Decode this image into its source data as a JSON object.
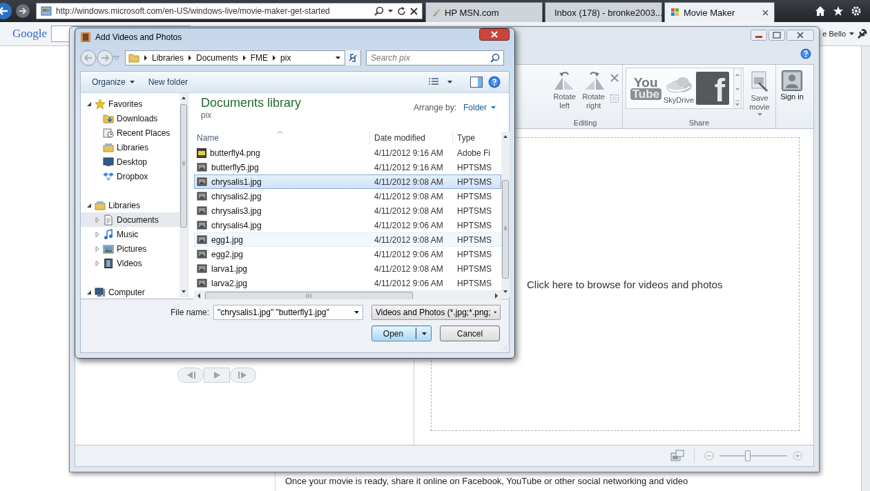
{
  "browser": {
    "address": "http://windows.microsoft.com/en-US/windows-live/movie-maker-get-started",
    "tabs": [
      {
        "label": "HP MSN.com",
        "selected": false
      },
      {
        "label": "Inbox (178) - bronke2003...",
        "selected": false
      },
      {
        "label": "Movie Maker",
        "selected": true
      }
    ],
    "search_logo": "Google",
    "account": "e Bello"
  },
  "page": {
    "paragraph": "Once your movie is ready, share it online on Facebook, YouTube or other social networking and video"
  },
  "movie_maker": {
    "ribbon_groups": [
      {
        "label": "Editing",
        "items": [
          {
            "kind": "rotate_left",
            "label": "Rotate left"
          },
          {
            "kind": "rotate_right",
            "label": "Rotate right"
          },
          {
            "kind": "remove_select"
          }
        ]
      },
      {
        "label": "Share",
        "items": [
          {
            "kind": "youtube",
            "logo": [
              "You",
              "Tube"
            ]
          },
          {
            "kind": "skydrive",
            "label": "SkyDrive"
          },
          {
            "kind": "facebook",
            "logo": [
              "f"
            ]
          },
          {
            "kind": "gallery_scroll"
          },
          {
            "kind": "save_movie",
            "label": "Save movie"
          }
        ]
      },
      {
        "items": [
          {
            "kind": "sign_in",
            "label": "Sign in"
          }
        ]
      }
    ],
    "storyboard_prompt": "Click here to browse for videos and photos",
    "zoom": {
      "level": 0.42
    }
  },
  "dialog": {
    "title": "Add Videos and Photos",
    "breadcrumb": [
      "Libraries",
      "Documents",
      "FME",
      "pix"
    ],
    "search": {
      "placeholder": "Search pix"
    },
    "toolbar": [
      {
        "label": "Organize",
        "menu": true
      },
      {
        "label": "New folder",
        "menu": false
      }
    ],
    "nav_tree": [
      {
        "label": "Favorites",
        "kind": "star",
        "expanded": true,
        "selected": false,
        "children": [
          {
            "label": "Downloads",
            "kind": "downloads",
            "selected": false
          },
          {
            "label": "Recent Places",
            "kind": "recent",
            "selected": false
          },
          {
            "label": "Libraries",
            "kind": "libraries",
            "selected": false
          },
          {
            "label": "Desktop",
            "kind": "desktop",
            "selected": false
          },
          {
            "label": "Dropbox",
            "kind": "dropbox",
            "selected": false
          }
        ]
      },
      {
        "label": "Libraries",
        "kind": "libraries",
        "expanded": true,
        "selected": false,
        "children": [
          {
            "label": "Documents",
            "kind": "document",
            "expanded": false,
            "selected": true
          },
          {
            "label": "Music",
            "kind": "music",
            "expanded": false,
            "selected": false
          },
          {
            "label": "Pictures",
            "kind": "pictures",
            "expanded": false,
            "selected": false
          },
          {
            "label": "Videos",
            "kind": "videos",
            "expanded": false,
            "selected": false
          }
        ]
      },
      {
        "label": "Computer",
        "kind": "computer",
        "expanded": true,
        "selected": false
      }
    ],
    "library_title": "Documents library",
    "library_subtitle": "pix",
    "arrange_label": "Arrange by:",
    "arrange_value": "Folder",
    "columns": [
      "Name",
      "Date modified",
      "Type"
    ],
    "rows": [
      {
        "kind": "fireworks",
        "name": "butterfly4.png",
        "date": "4/11/2012 9:16 AM",
        "type": "Adobe Fi",
        "selected": false,
        "hovered": false
      },
      {
        "kind": "image",
        "name": "butterfly5.jpg",
        "date": "4/11/2012 9:16 AM",
        "type": "HPTSMS",
        "selected": false,
        "hovered": false
      },
      {
        "kind": "image",
        "name": "chrysalis1.jpg",
        "date": "4/11/2012 9:08 AM",
        "type": "HPTSMS",
        "selected": true,
        "hovered": false
      },
      {
        "kind": "image",
        "name": "chrysalis2.jpg",
        "date": "4/11/2012 9:08 AM",
        "type": "HPTSMS",
        "selected": false,
        "hovered": false
      },
      {
        "kind": "image",
        "name": "chrysalis3.jpg",
        "date": "4/11/2012 9:08 AM",
        "type": "HPTSMS",
        "selected": false,
        "hovered": false
      },
      {
        "kind": "image",
        "name": "chrysalis4.jpg",
        "date": "4/11/2012 9:06 AM",
        "type": "HPTSMS",
        "selected": false,
        "hovered": false
      },
      {
        "kind": "image",
        "name": "egg1.jpg",
        "date": "4/11/2012 9:08 AM",
        "type": "HPTSMS",
        "selected": false,
        "hovered": true
      },
      {
        "kind": "image",
        "name": "egg2.jpg",
        "date": "4/11/2012 9:06 AM",
        "type": "HPTSMS",
        "selected": false,
        "hovered": false
      },
      {
        "kind": "image",
        "name": "larva1.jpg",
        "date": "4/11/2012 9:08 AM",
        "type": "HPTSMS",
        "selected": false,
        "hovered": false
      },
      {
        "kind": "image",
        "name": "larva2.jpg",
        "date": "4/11/2012 9:06 AM",
        "type": "HPTSMS",
        "selected": false,
        "hovered": false
      }
    ],
    "file_name_label": "File name:",
    "file_name": "\"chrysalis1.jpg\" \"butterfly1.jpg\"",
    "file_type": "Videos and Photos (*.jpg;*.png;",
    "buttons": [
      {
        "label": "Open",
        "default": true,
        "split": true
      },
      {
        "label": "Cancel",
        "default": false,
        "split": false
      }
    ]
  }
}
